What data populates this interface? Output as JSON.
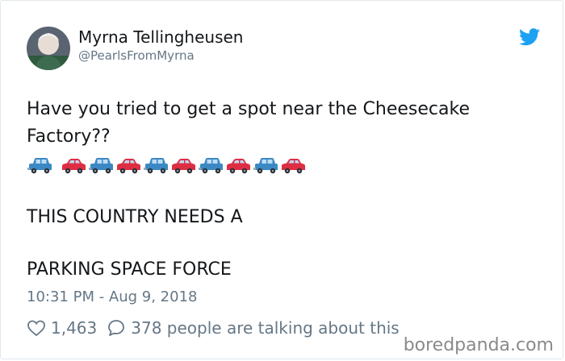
{
  "author": {
    "name": "Myrna Tellingheusen",
    "handle": "@PearlsFromMyrna"
  },
  "tweet": {
    "line1": "Have you tried to get a spot near the Cheesecake",
    "line2": "Factory??",
    "cars": [
      "blue",
      "red",
      "blue",
      "red",
      "blue",
      "red",
      "blue",
      "red",
      "blue",
      "red"
    ],
    "line3": "THIS COUNTRY NEEDS A",
    "line4": "PARKING SPACE FORCE"
  },
  "meta": {
    "timestamp": "10:31 PM - Aug 9, 2018"
  },
  "actions": {
    "likes": "1,463",
    "replies_text": "378 people are talking about this"
  },
  "watermark": "boredpanda.com",
  "colors": {
    "twitter_blue": "#1da1f2",
    "car_blue": "#3b88c3",
    "car_red": "#dd2e44",
    "secondary_text": "#657786"
  }
}
